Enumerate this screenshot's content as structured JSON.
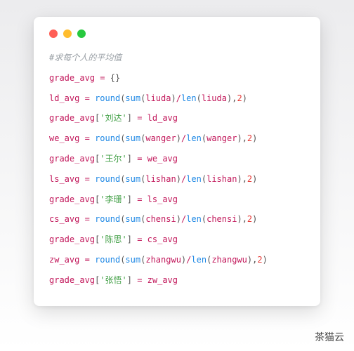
{
  "comment": "#求每个人的平均值",
  "lines": [
    {
      "lhs": "grade_avg",
      "rhs_type": "empty_dict",
      "dict": "{}"
    },
    {
      "lhs": "ld_avg",
      "rhs_type": "round",
      "arg": "liuda",
      "prec": "2"
    },
    {
      "lhs": "grade_avg",
      "rhs_type": "assign_idx",
      "key": "'刘达'",
      "val": "ld_avg"
    },
    {
      "lhs": "we_avg",
      "rhs_type": "round",
      "arg": "wanger",
      "prec": "2"
    },
    {
      "lhs": "grade_avg",
      "rhs_type": "assign_idx",
      "key": "'王尔'",
      "val": "we_avg"
    },
    {
      "lhs": "ls_avg",
      "rhs_type": "round",
      "arg": "lishan",
      "prec": "2"
    },
    {
      "lhs": "grade_avg",
      "rhs_type": "assign_idx",
      "key": "'李珊'",
      "val": "ls_avg"
    },
    {
      "lhs": "cs_avg",
      "rhs_type": "round",
      "arg": "chensi",
      "prec": "2"
    },
    {
      "lhs": "grade_avg",
      "rhs_type": "assign_idx",
      "key": "'陈思'",
      "val": "cs_avg"
    },
    {
      "lhs": "zw_avg",
      "rhs_type": "round",
      "arg": "zhangwu",
      "prec": "2"
    },
    {
      "lhs": "grade_avg",
      "rhs_type": "assign_idx",
      "key": "'张悟'",
      "val": "zw_avg"
    }
  ],
  "fn_round": "round",
  "fn_sum": "sum",
  "fn_len": "len",
  "signature": "茶猫云"
}
